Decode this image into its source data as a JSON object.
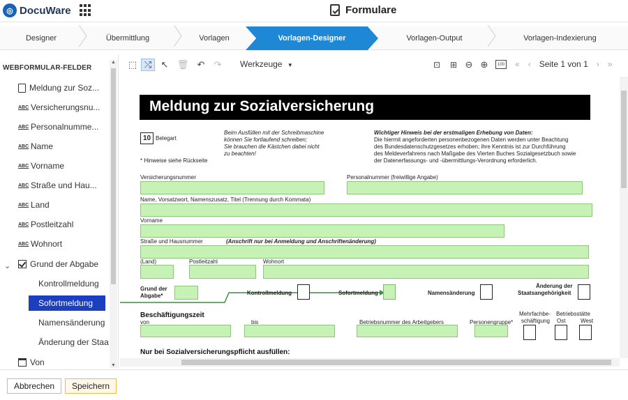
{
  "app": {
    "brand": "DocuWare",
    "title": "Formulare"
  },
  "steps": [
    "Designer",
    "Übermittlung",
    "Vorlagen",
    "Vorlagen-Designer",
    "Vorlagen-Output",
    "Vorlagen-Indexierung"
  ],
  "active_step": "Vorlagen-Designer",
  "left_panel": {
    "heading": "WEBFORMULAR-FELDER",
    "fields": [
      {
        "icon": "document-icon",
        "label": "Meldung zur Soz..."
      },
      {
        "icon": "abc-icon",
        "label": "Versicherungsnu..."
      },
      {
        "icon": "abc-icon",
        "label": "Personalnumme..."
      },
      {
        "icon": "abc-icon",
        "label": "Name"
      },
      {
        "icon": "abc-icon",
        "label": "Vorname"
      },
      {
        "icon": "abc-icon",
        "label": "Straße und Hau..."
      },
      {
        "icon": "abc-icon",
        "label": "Land"
      },
      {
        "icon": "abc-icon",
        "label": "Postleitzahl"
      },
      {
        "icon": "abc-icon",
        "label": "Wohnort"
      },
      {
        "icon": "checkbox-icon",
        "label": "Grund der Abgabe"
      }
    ],
    "abc_glyph": "ABC",
    "subitems": [
      "Kontrollmeldung",
      "Sofortmeldung",
      "Namensänderung",
      "Änderung der Staa"
    ],
    "selected_subitem": "Sofortmeldung",
    "last_field": {
      "icon": "calendar-icon",
      "label": "Von"
    }
  },
  "toolbar": {
    "tools_menu": "Werkzeuge",
    "page_label": "Seite 1 von 1",
    "zoom_100": "100"
  },
  "form": {
    "title": "Meldung zur Sozialversicherung",
    "belegart_num": "10",
    "belegart_label": "Belegart",
    "hinweise": "* Hinweise siehe Rückseite",
    "typewriter_note": [
      "Beim Ausfüllen mit der Schreibmaschine",
      "können Sie fortlaufend schreiben;",
      "Sie brauchen die Kästchen dabei nicht",
      "zu beachten!"
    ],
    "important_title": "Wichtiger Hinweis bei der erstmaligen Erhebung von Daten:",
    "important_text": [
      "Die hiermit angeforderten personenbezogenen Daten werden unter Beachtung",
      "des Bundesdatenschutzgesetzes erhoben; ihre Kenntnis ist zur Durchführung",
      "des Meldeverfahrens nach Maßgabe des Vierten Buches Sozialgesetzbuch sowie",
      "der Datenerfassungs- und -übermittlungs-Verordnung erforderlich."
    ],
    "label_versnr": "Versicherungsnummer",
    "label_persnr": "Personalnummer (freiwillige Angabe)",
    "label_name": "Name, Vorsatzwort, Namenszusatz, Titel (Trennung durch Kommata)",
    "label_vorname": "Vorname",
    "label_strasse": "Straße und Hausnummer",
    "label_strasse_note": "(Anschrift nur bei Anmeldung und Anschriftenänderung)",
    "label_land": "(Land)",
    "label_plz": "Postleitzahl",
    "label_wohnort": "Wohnort",
    "grund_label": [
      "Grund der",
      "Abgabe*"
    ],
    "opt_kontroll": "Kontrollmeldung",
    "opt_sofort": "Sofortmeldung",
    "opt_namens": "Namensänderung",
    "opt_staats": [
      "Änderung der",
      "Staatsangehörigkeit"
    ],
    "section_beschaeftigung": "Beschäftigungszeit",
    "label_von": "von",
    "label_bis": "bis",
    "label_betriebsnr": "Betriebsnummer des Arbeitgebers",
    "label_personengruppe": "Personengruppe*",
    "label_mehrfach": [
      "Mehrfachbe-",
      "schäftigung"
    ],
    "label_betriebsstaette": [
      "Betriebsstätte",
      "Ost",
      "West"
    ],
    "section_svpflicht": "Nur bei Sozialversicherungspflicht ausfüllen:"
  },
  "buttons": {
    "cancel": "Abbrechen",
    "save": "Speichern"
  },
  "colors": {
    "accent": "#1e88d6",
    "selected": "#1c3fbf",
    "field_fill": "#c6f2b5",
    "connector": "#3d8b3d"
  }
}
